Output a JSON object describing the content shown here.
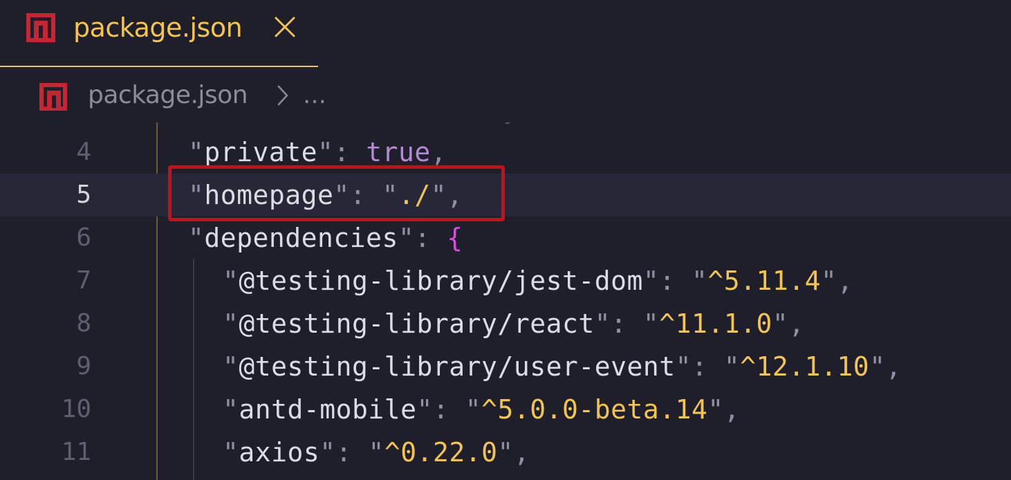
{
  "tab": {
    "label": "package.json",
    "icon": "npm-icon",
    "close_icon": "close-icon",
    "active_color": "#f2c552"
  },
  "breadcrumb": {
    "icon": "npm-icon",
    "file": "package.json",
    "separator_icon": "chevron-right-icon",
    "more": "…"
  },
  "colors": {
    "background": "#1e1f2b",
    "string": "#f2c552",
    "boolean": "#b18bd0",
    "brace": "#d44fd6",
    "highlight": "#c8101b",
    "npm_red": "#c62634"
  },
  "code": {
    "current_line": "5",
    "lines": [
      {
        "num": "4",
        "key": "private",
        "colon": ": ",
        "value": "true",
        "value_type": "bool",
        "trail": ","
      },
      {
        "num": "5",
        "key": "homepage",
        "colon": ": ",
        "value": "./",
        "value_type": "string",
        "trail": ","
      },
      {
        "num": "6",
        "key": "dependencies",
        "colon": ": ",
        "value": "{",
        "value_type": "brace",
        "trail": ""
      },
      {
        "num": "7",
        "key": "@testing-library/jest-dom",
        "colon": ": ",
        "value": "^5.11.4",
        "value_type": "string",
        "trail": ","
      },
      {
        "num": "8",
        "key": "@testing-library/react",
        "colon": ": ",
        "value": "^11.1.0",
        "value_type": "string",
        "trail": ","
      },
      {
        "num": "9",
        "key": "@testing-library/user-event",
        "colon": ": ",
        "value": "^12.1.10",
        "value_type": "string",
        "trail": ","
      },
      {
        "num": "10",
        "key": "antd-mobile",
        "colon": ": ",
        "value": "^5.0.0-beta.14",
        "value_type": "string",
        "trail": ","
      },
      {
        "num": "11",
        "key": "axios",
        "colon": ": ",
        "value": "^0.22.0",
        "value_type": "string",
        "trail": ","
      }
    ]
  }
}
